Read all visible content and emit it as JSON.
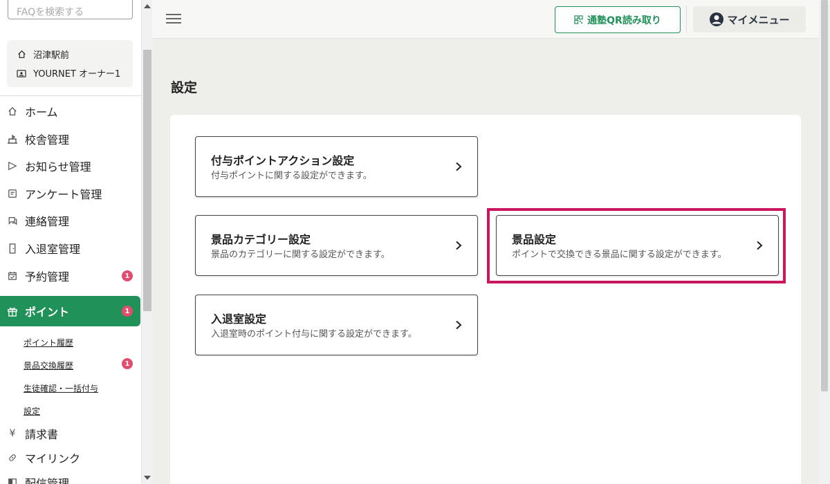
{
  "sidebar": {
    "search_placeholder": "FAQを検索する",
    "school": {
      "name": "沼津駅前",
      "user": "YOURNET オーナー1"
    },
    "items": [
      {
        "label": "ホーム",
        "icon": "home-icon"
      },
      {
        "label": "校舎管理",
        "icon": "building-icon"
      },
      {
        "label": "お知らせ管理",
        "icon": "send-icon"
      },
      {
        "label": "アンケート管理",
        "icon": "survey-icon"
      },
      {
        "label": "連絡管理",
        "icon": "chat-icon"
      },
      {
        "label": "入退室管理",
        "icon": "door-icon"
      },
      {
        "label": "予約管理",
        "icon": "calendar-icon",
        "badge": "1"
      },
      {
        "label": "ポイント",
        "icon": "gift-icon",
        "badge": "1",
        "active": true
      },
      {
        "label": "請求書",
        "icon": "yen-icon"
      },
      {
        "label": "マイリンク",
        "icon": "link-icon"
      },
      {
        "label": "配信管理",
        "icon": "broadcast-icon"
      }
    ],
    "sub_items": [
      {
        "label": "ポイント履歴"
      },
      {
        "label": "景品交換履歴",
        "badge": "1"
      },
      {
        "label": "生徒確認・一括付与"
      },
      {
        "label": "設定"
      }
    ]
  },
  "header": {
    "qr_label": "通塾QR読み取り",
    "menu_label": "マイメニュー"
  },
  "main": {
    "title": "設定",
    "cards": [
      {
        "title": "付与ポイントアクション設定",
        "desc": "付与ポイントに関する設定ができます。"
      },
      {
        "title": "景品カテゴリー設定",
        "desc": "景品のカテゴリーに関する設定ができます。"
      },
      {
        "title": "景品設定",
        "desc": "ポイントで交換できる景品に関する設定ができます。",
        "highlighted": true
      },
      {
        "title": "入退室設定",
        "desc": "入退室時のポイント付与に関する設定ができます。"
      }
    ]
  },
  "colors": {
    "accent": "#21915a",
    "badge": "#e14d6e",
    "highlight": "#c8175d"
  }
}
